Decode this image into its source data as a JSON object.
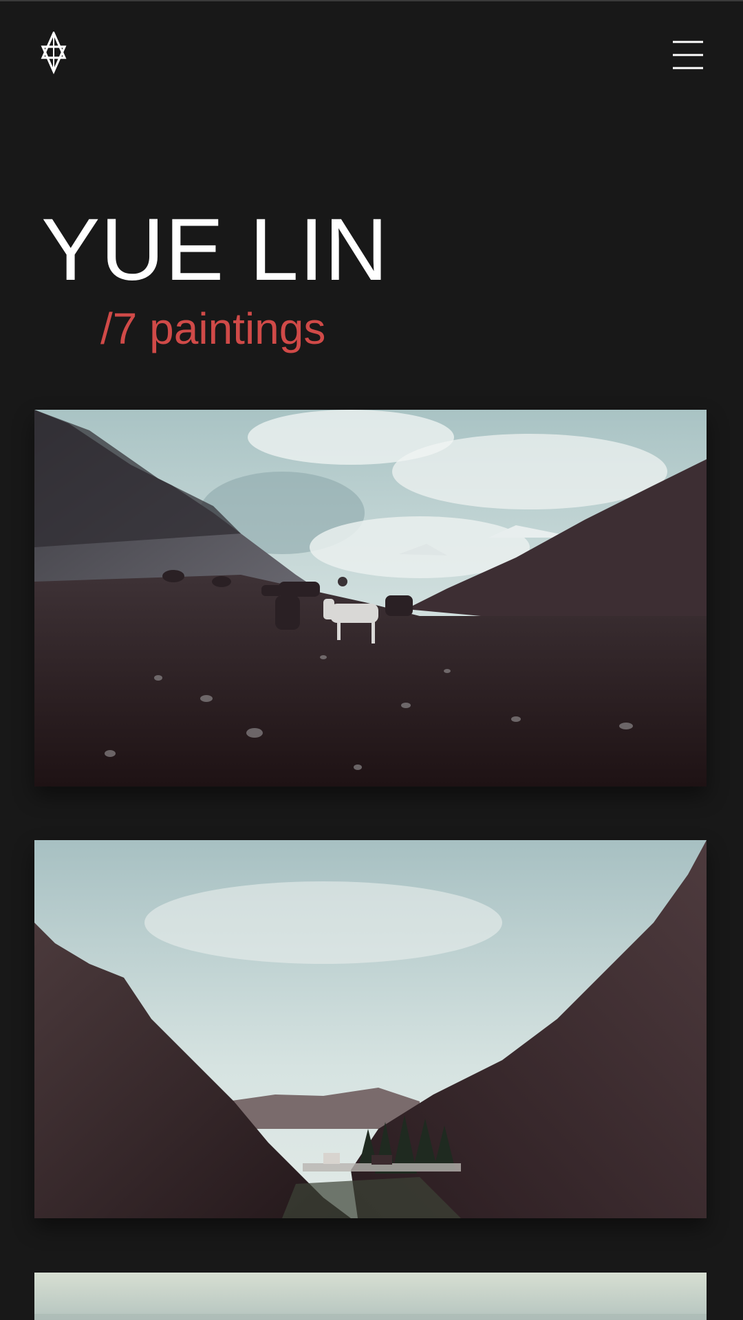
{
  "header": {
    "logo_icon": "stacked-triangles-monogram-icon",
    "menu_icon": "hamburger-menu-icon"
  },
  "artist": {
    "name": "YUE LIN",
    "painting_count": "/7 paintings"
  },
  "gallery": {
    "items": [
      {
        "subject": "mountain valley with horses and rider under cloudy sky"
      },
      {
        "subject": "green mountain valley with trees and small village"
      },
      {
        "subject": "pale sky landscape (partially visible)"
      }
    ]
  },
  "colors": {
    "background": "#181818",
    "title": "#ffffff",
    "accent": "#d04a48"
  }
}
